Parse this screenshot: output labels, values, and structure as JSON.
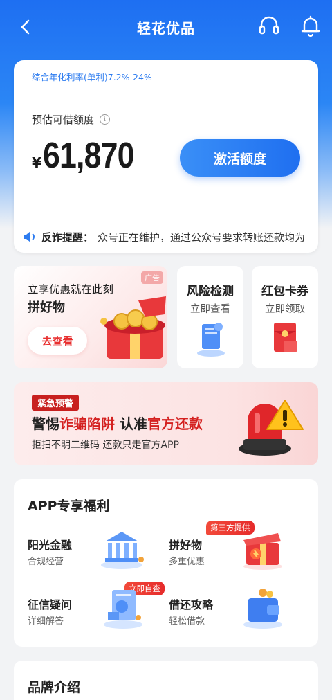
{
  "header": {
    "title": "轻花优品"
  },
  "loan_card": {
    "rate_text": "综合年化利率(单利)7.2%-24%",
    "estimate_label": "预估可借额度",
    "info_glyph": "i",
    "currency": "¥",
    "amount": "61,870",
    "activate_label": "激活额度",
    "notice_label": "反诈提醒：",
    "notice_text": "众号正在维护，通过公众号要求转账还款均为"
  },
  "promo": {
    "ad_tag": "广告",
    "line1": "立享优惠就在此刻",
    "line2": "拼好物",
    "button": "去查看"
  },
  "mini_cards": [
    {
      "title": "风险检测",
      "subtitle": "立即查看"
    },
    {
      "title": "红包卡券",
      "subtitle": "立即领取"
    }
  ],
  "alert": {
    "tag": "紧急预警",
    "heading_a": "警惕",
    "heading_b": "诈骗陷阱",
    "heading_c": " 认准",
    "heading_d": "官方还款",
    "subtitle": "拒扫不明二维码 还款只走官方APP"
  },
  "benefits": {
    "title": "APP专享福利",
    "items": [
      {
        "title": "阳光金融",
        "subtitle": "合规经营",
        "tag": ""
      },
      {
        "title": "拼好物",
        "subtitle": "多重优惠",
        "tag": "第三方提供"
      },
      {
        "title": "征信疑问",
        "subtitle": "详细解答",
        "tag": "立即自查"
      },
      {
        "title": "借还攻略",
        "subtitle": "轻松借款",
        "tag": ""
      }
    ]
  },
  "brand": {
    "title": "品牌介绍"
  },
  "colors": {
    "primary": "#1f6ff0",
    "alert_red": "#d42120"
  }
}
